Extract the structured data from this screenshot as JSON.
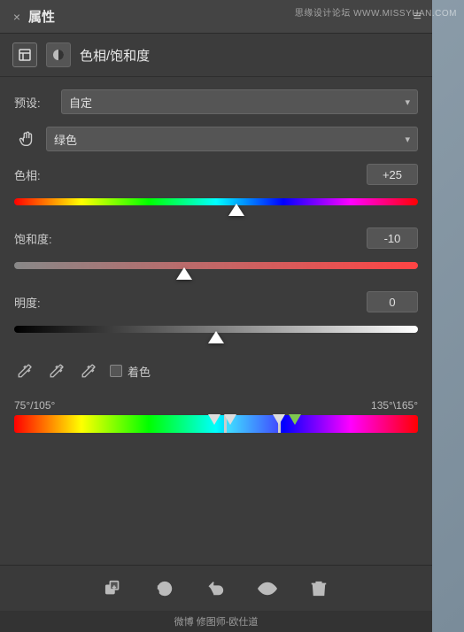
{
  "watermark": {
    "text": "思缘设计论坛 WWW.MISSYUAN.COM"
  },
  "titleBar": {
    "closeLabel": "×",
    "title": "属性",
    "menuIcon": "≡"
  },
  "subHeader": {
    "icon1": "▣",
    "icon2": "●",
    "title": "色相/饱和度"
  },
  "presetRow": {
    "label": "预设:",
    "value": "自定",
    "arrow": "▾"
  },
  "channelRow": {
    "handIcon": "☞",
    "value": "绿色",
    "arrow": "▾"
  },
  "hueSlider": {
    "label": "色相:",
    "value": "+25",
    "thumbPercent": 55
  },
  "saturationSlider": {
    "label": "饱和度:",
    "value": "-10",
    "thumbPercent": 42
  },
  "lightnessSlider": {
    "label": "明度:",
    "value": "0",
    "thumbPercent": 50
  },
  "tools": {
    "eyedropper1Icon": "eyedropper",
    "eyedropper2Icon": "eyedropper-plus",
    "eyedropper3Icon": "eyedropper-minus",
    "colorizeLabel": "着色"
  },
  "colorRange": {
    "leftLabel": "75°/105°",
    "rightLabel": "135°\\165°"
  },
  "bottomToolbar": {
    "items": [
      {
        "name": "add-layer",
        "icon": "add-layer"
      },
      {
        "name": "reset",
        "icon": "reset"
      },
      {
        "name": "undo",
        "icon": "undo"
      },
      {
        "name": "visibility",
        "icon": "eye"
      },
      {
        "name": "delete",
        "icon": "trash"
      }
    ]
  },
  "bottomWatermark": {
    "text": "微博 修图师-欧仕道"
  }
}
